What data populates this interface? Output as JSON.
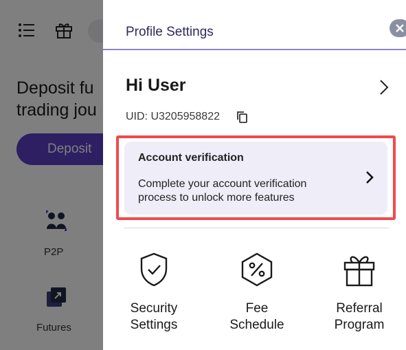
{
  "background": {
    "heading": "Deposit fu\ntrading jou",
    "deposit_label": "Deposit",
    "shortcuts": [
      {
        "label": "P2P",
        "icon": "p2p-icon"
      },
      {
        "label": "Futures",
        "icon": "futures-icon"
      }
    ]
  },
  "drawer": {
    "title": "Profile Settings",
    "greeting": "Hi User",
    "uid": "UID: U3205958822",
    "verification": {
      "title": "Account verification",
      "description": "Complete your account verification process to unlock more features"
    },
    "quick_actions": [
      {
        "label": "Security\nSettings",
        "icon": "shield-check-icon"
      },
      {
        "label": "Fee\nSchedule",
        "icon": "percent-badge-icon"
      },
      {
        "label": "Referral\nProgram",
        "icon": "gift-icon"
      }
    ]
  },
  "colors": {
    "accent": "#5b3fc4",
    "title_text": "#2c2a5a",
    "highlight": "#ef4a4f",
    "card_bg": "#eeedf8",
    "overlay": "rgba(0,0,0,0.5)"
  }
}
